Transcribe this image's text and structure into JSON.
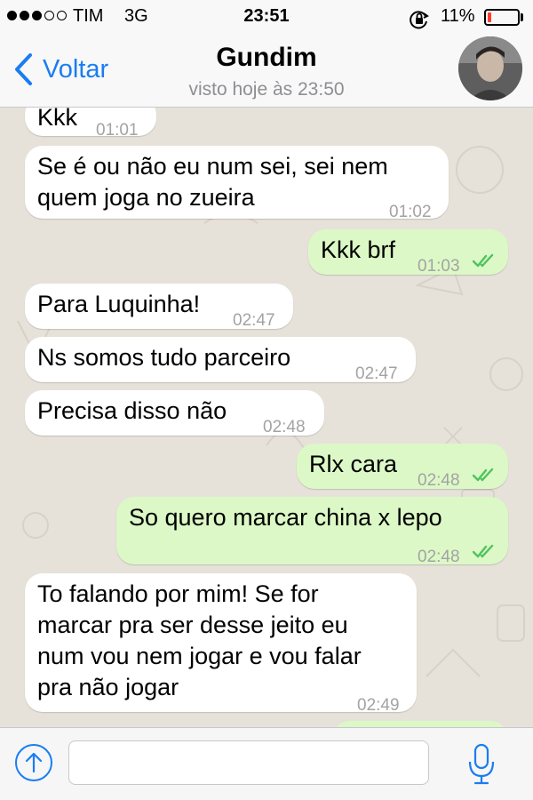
{
  "status_bar": {
    "carrier": "TIM",
    "network": "3G",
    "time": "23:51",
    "battery_percent": "11%",
    "battery_level": 0.11,
    "signal_bars_filled": 3,
    "signal_bars_total": 5,
    "battery_color": "#ff3b30"
  },
  "nav": {
    "back_label": "Voltar",
    "contact_name": "Gundim",
    "contact_status": "visto hoje às 23:50",
    "accent_color": "#1a7df1"
  },
  "messages": [
    {
      "dir": "in",
      "lines": [
        "Kkk"
      ],
      "time": "01:01"
    },
    {
      "dir": "in",
      "lines": [
        "Se é ou não eu num sei, sei nem",
        "quem joga no zueira"
      ],
      "time": "01:02"
    },
    {
      "dir": "out",
      "lines": [
        "Kkk brf"
      ],
      "time": "01:03",
      "read": true
    },
    {
      "dir": "in",
      "lines": [
        "Para Luquinha!"
      ],
      "time": "02:47"
    },
    {
      "dir": "in",
      "lines": [
        "Ns somos tudo parceiro"
      ],
      "time": "02:47"
    },
    {
      "dir": "in",
      "lines": [
        "Precisa disso não"
      ],
      "time": "02:48"
    },
    {
      "dir": "out",
      "lines": [
        "Rlx cara"
      ],
      "time": "02:48",
      "read": true
    },
    {
      "dir": "out",
      "lines": [
        "So quero marcar china x lepo"
      ],
      "time": "02:48",
      "read": true
    },
    {
      "dir": "in",
      "lines": [
        "To falando por mim! Se for",
        "marcar pra ser desse jeito eu",
        "num vou nem jogar e vou falar",
        "pra não jogar"
      ],
      "time": "02:49"
    },
    {
      "dir": "out",
      "lines": [],
      "time": ""
    }
  ],
  "input": {
    "value": "",
    "placeholder": ""
  },
  "icons": {
    "back": "chevron-left-icon",
    "lock": "orientation-lock-icon",
    "attach": "upload-arrow-icon",
    "mic": "microphone-icon",
    "read": "double-check-icon"
  },
  "colors": {
    "incoming_bubble": "#ffffff",
    "outgoing_bubble": "#dcf8c6",
    "read_ticks": "#4fc35f",
    "timestamp": "#a3a3a3"
  }
}
